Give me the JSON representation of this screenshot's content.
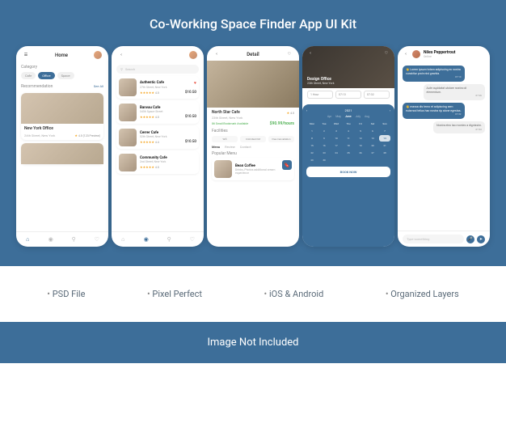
{
  "title": "Co-Working Space Finder App UI Kit",
  "features": [
    "PSD File",
    "Pixel Perfect",
    "iOS & Android",
    "Organized Layers"
  ],
  "footer": "Image Not Included",
  "phones": {
    "home": {
      "title": "Home",
      "category_label": "Category",
      "chips": [
        "Cafe",
        "Office",
        "Space"
      ],
      "active_chip": 1,
      "reco_label": "Recommendation",
      "see_all": "See All",
      "card1": {
        "title": "New York Office",
        "sub": "24th Street, New York",
        "rating": "4.5 (123 Preview)"
      }
    },
    "list": {
      "search_placeholder": "Search",
      "items": [
        {
          "title": "Authentic Cafe",
          "sub": "27th Street, New York",
          "rating": "4.5",
          "price": "$10.50"
        },
        {
          "title": "Banvau Cafe",
          "sub": "3456 Space Street",
          "rating": "4.5",
          "price": "$10.50"
        },
        {
          "title": "Cerrer Cafe",
          "sub": "52th Street, New York",
          "rating": "4.4",
          "price": "$10.50"
        },
        {
          "title": "Community Cafe",
          "sub": "2nd Street, New York",
          "rating": "4.5",
          "price": ""
        }
      ]
    },
    "detail": {
      "title": "Detail",
      "place": "North Star Cafe",
      "sub": "23th Street, New York",
      "rating": "4.5",
      "avail": "86 Small Bookmark Available",
      "price": "$90.99/hours",
      "fac_label": "Facilities",
      "facilities": [
        "Wifi",
        "Unlimited KM",
        "Free Cancellation"
      ],
      "tabs": [
        "Menu",
        "Review",
        "Contact"
      ],
      "pop_label": "Popular Menu",
      "menu_item": {
        "title": "Bean Coffee",
        "sub": "Drinks, Photos additional cream experience"
      }
    },
    "booking": {
      "place": "Design Office",
      "sub": "23th Street, New York",
      "year": "2021",
      "months": [
        "Apr",
        "May",
        "June",
        "July",
        "Aug"
      ],
      "active_month": 2,
      "day_headers": [
        "Mon",
        "Tue",
        "Wed",
        "Thu",
        "Fri",
        "Sat",
        "Sun"
      ],
      "selected_days": [
        14
      ],
      "time": {
        "h": "1 Hour",
        "start": "07:10",
        "end": "07:32"
      },
      "btn": "BOOK NOW"
    },
    "chat": {
      "name": "Niles Peppertrout",
      "status": "Online",
      "msgs": [
        {
          "dir": "in",
          "text": "Lorem ipsum totam adipiscing ex nostra curabitur proin nisi gravida.",
          "time": "07:10"
        },
        {
          "dir": "out",
          "text": "Aute cupidatat utolare nostra oil elementum.",
          "time": "07:26"
        },
        {
          "dir": "in",
          "text": "massa dis temo et adipiscing sem euismod tellus hac nostra rip alone egestas.",
          "time": "07:32"
        },
        {
          "dir": "out",
          "text": "Nostra eleo lao montes a dignissim.",
          "time": "07:32"
        }
      ],
      "input_placeholder": "Type something"
    }
  }
}
